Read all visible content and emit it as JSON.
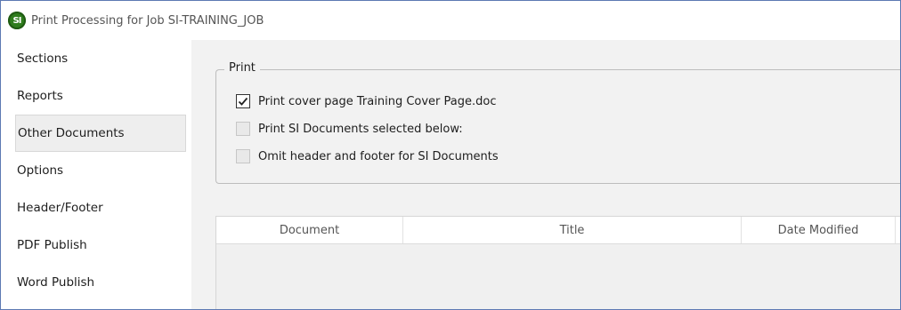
{
  "window": {
    "title": "Print Processing for Job SI-TRAINING_JOB",
    "icon": "si-app-icon",
    "icon_text": "SI"
  },
  "sidebar": {
    "items": [
      {
        "label": "Sections",
        "selected": false
      },
      {
        "label": "Reports",
        "selected": false
      },
      {
        "label": "Other Documents",
        "selected": true
      },
      {
        "label": "Options",
        "selected": false
      },
      {
        "label": "Header/Footer",
        "selected": false
      },
      {
        "label": "PDF Publish",
        "selected": false
      },
      {
        "label": "Word Publish",
        "selected": false
      }
    ]
  },
  "print_group": {
    "legend": "Print",
    "options": [
      {
        "label": "Print cover page Training Cover Page.doc",
        "checked": true
      },
      {
        "label": "Print SI Documents selected below:",
        "checked": false
      },
      {
        "label": "Omit header and footer for SI Documents",
        "checked": false
      }
    ]
  },
  "documents_table": {
    "columns": [
      "Document",
      "Title",
      "Date Modified"
    ],
    "rows": []
  },
  "colors": {
    "window_border": "#5d79b3",
    "content_bg": "#f2f2f2",
    "app_icon_green": "#2f7d1d"
  }
}
